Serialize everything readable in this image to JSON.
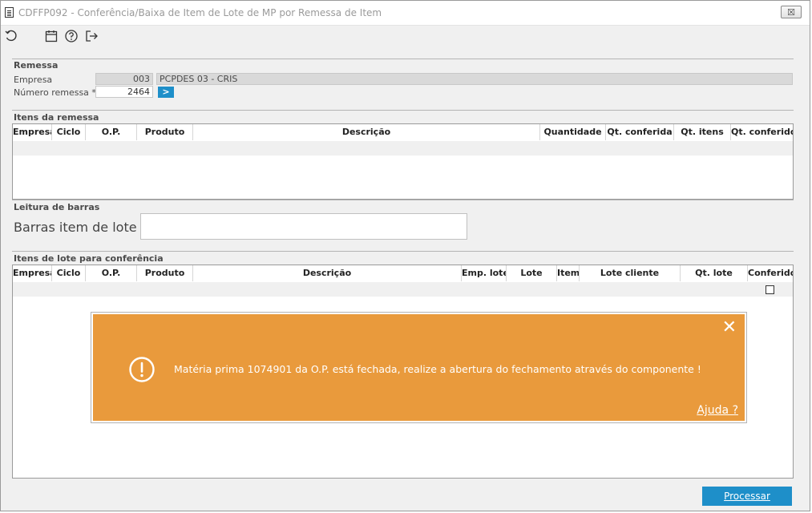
{
  "window": {
    "title": "CDFFP092 - Conferência/Baixa de Item de Lote de MP por Remessa de Item",
    "close_label": "☒"
  },
  "toolbar": {
    "icons": [
      "refresh-icon",
      "calendar-icon",
      "help-icon",
      "exit-icon"
    ]
  },
  "remessa": {
    "section_title": "Remessa",
    "empresa_label": "Empresa",
    "empresa_code": "003",
    "empresa_name": "PCPDES 03 - CRIS",
    "numero_label": "Número remessa *",
    "numero_value": "2464",
    "go_label": ">"
  },
  "itens_remessa": {
    "section_title": "Itens da remessa",
    "columns": [
      "Empresa",
      "Ciclo",
      "O.P.",
      "Produto",
      "Descrição",
      "Quantidade",
      "Qt. conferida",
      "Qt. itens",
      "Qt. conferido"
    ]
  },
  "leitura": {
    "section_title": "Leitura de barras",
    "barras_label": "Barras item de lote",
    "barras_value": ""
  },
  "itens_lote": {
    "section_title": "Itens de lote para conferência",
    "columns": [
      "Empresa",
      "Ciclo",
      "O.P.",
      "Produto",
      "Descrição",
      "Emp. lote",
      "Lote",
      "Item",
      "Lote cliente",
      "Qt. lote",
      "Conferido"
    ]
  },
  "toast": {
    "message": "Matéria prima 1074901 da O.P.  está fechada, realize a abertura do fechamento através do componente !",
    "help_label": "Ajuda ?",
    "close_label": "✕",
    "background": "#e99a3c"
  },
  "actions": {
    "process_label": "Processar",
    "accent": "#1e8fc9"
  }
}
